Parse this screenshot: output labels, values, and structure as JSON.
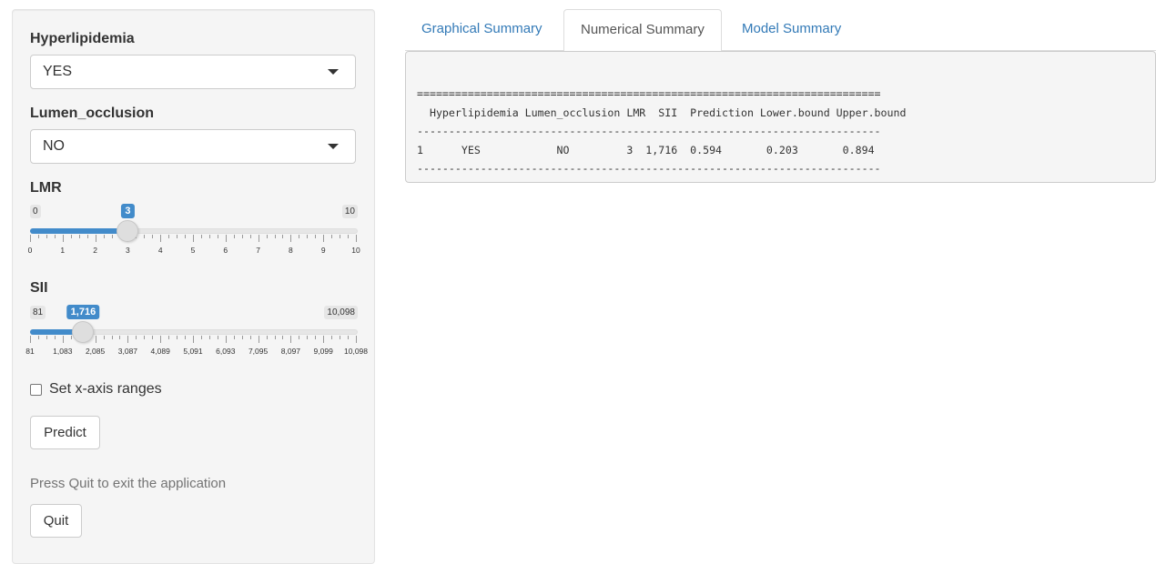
{
  "sidebar": {
    "hyperlipidemia": {
      "label": "Hyperlipidemia",
      "value": "YES"
    },
    "lumen_occlusion": {
      "label": "Lumen_occlusion",
      "value": "NO"
    },
    "lmr": {
      "label": "LMR",
      "min": "0",
      "max": "10",
      "value": "3",
      "value_num": 3,
      "min_num": 0,
      "max_num": 10,
      "ticks": [
        "0",
        "1",
        "2",
        "3",
        "4",
        "5",
        "6",
        "7",
        "8",
        "9",
        "10"
      ]
    },
    "sii": {
      "label": "SII",
      "min": "81",
      "max": "10,098",
      "value": "1,716",
      "value_num": 1716,
      "min_num": 81,
      "max_num": 10098,
      "ticks": [
        "81",
        "1,083",
        "2,085",
        "3,087",
        "4,089",
        "5,091",
        "6,093",
        "7,095",
        "8,097",
        "9,099",
        "10,098"
      ]
    },
    "checkbox_label": "Set x-axis ranges",
    "predict_label": "Predict",
    "help_text": "Press Quit to exit the application",
    "quit_label": "Quit"
  },
  "tabs": [
    {
      "label": "Graphical Summary",
      "active": false
    },
    {
      "label": "Numerical Summary",
      "active": true
    },
    {
      "label": "Model Summary",
      "active": false
    }
  ],
  "output": {
    "rule_top": "=========================================================================",
    "header": "  Hyperlipidemia Lumen_occlusion LMR  SII  Prediction Lower.bound Upper.bound",
    "rule_mid": "-------------------------------------------------------------------------",
    "row": "1      YES            NO         3  1,716  0.594       0.203       0.894",
    "rule_bottom": "-------------------------------------------------------------------------"
  },
  "colors": {
    "accent": "#428bca",
    "link": "#337ab7",
    "panel": "#f5f5f5"
  }
}
